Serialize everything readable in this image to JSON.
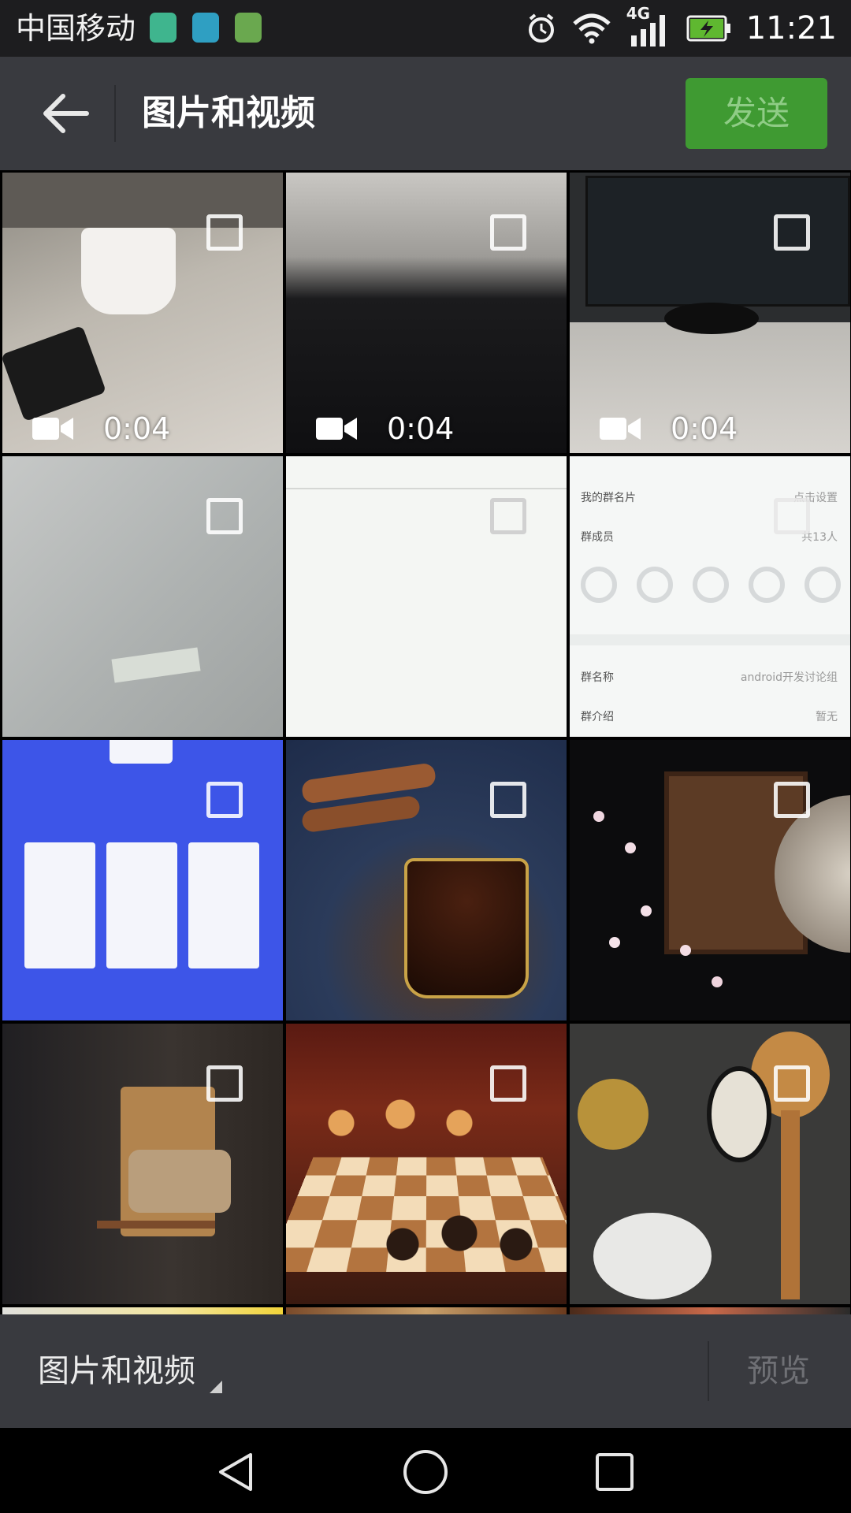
{
  "status": {
    "carrier": "中国移动",
    "network": "4G",
    "time": "11:21",
    "icons": [
      "usb-icon",
      "android-debug-icon",
      "android-icon",
      "alarm-icon",
      "wifi-icon",
      "signal-icon",
      "battery-charging-icon"
    ]
  },
  "header": {
    "title": "图片和视频",
    "send_label": "发送",
    "back_icon": "back-arrow-icon"
  },
  "grid": {
    "items": [
      {
        "type": "video",
        "duration": "0:04"
      },
      {
        "type": "video",
        "duration": "0:04"
      },
      {
        "type": "video",
        "duration": "0:04"
      },
      {
        "type": "image"
      },
      {
        "type": "image"
      },
      {
        "type": "image",
        "labels": [
          "我的群名片",
          "点击设置",
          "群成员",
          "共13人",
          "群名称",
          "android开发讨论组",
          "群介绍",
          "暂无"
        ]
      },
      {
        "type": "image"
      },
      {
        "type": "image"
      },
      {
        "type": "image"
      },
      {
        "type": "image"
      },
      {
        "type": "image"
      },
      {
        "type": "image"
      }
    ]
  },
  "footer": {
    "folder_label": "图片和视频",
    "preview_label": "预览"
  },
  "nav": {
    "icons": [
      "nav-back-icon",
      "nav-home-icon",
      "nav-recents-icon"
    ]
  },
  "colors": {
    "appbar": "#393a3f",
    "send_button": "#3f9a32",
    "status_bar": "#1d1d1f"
  }
}
